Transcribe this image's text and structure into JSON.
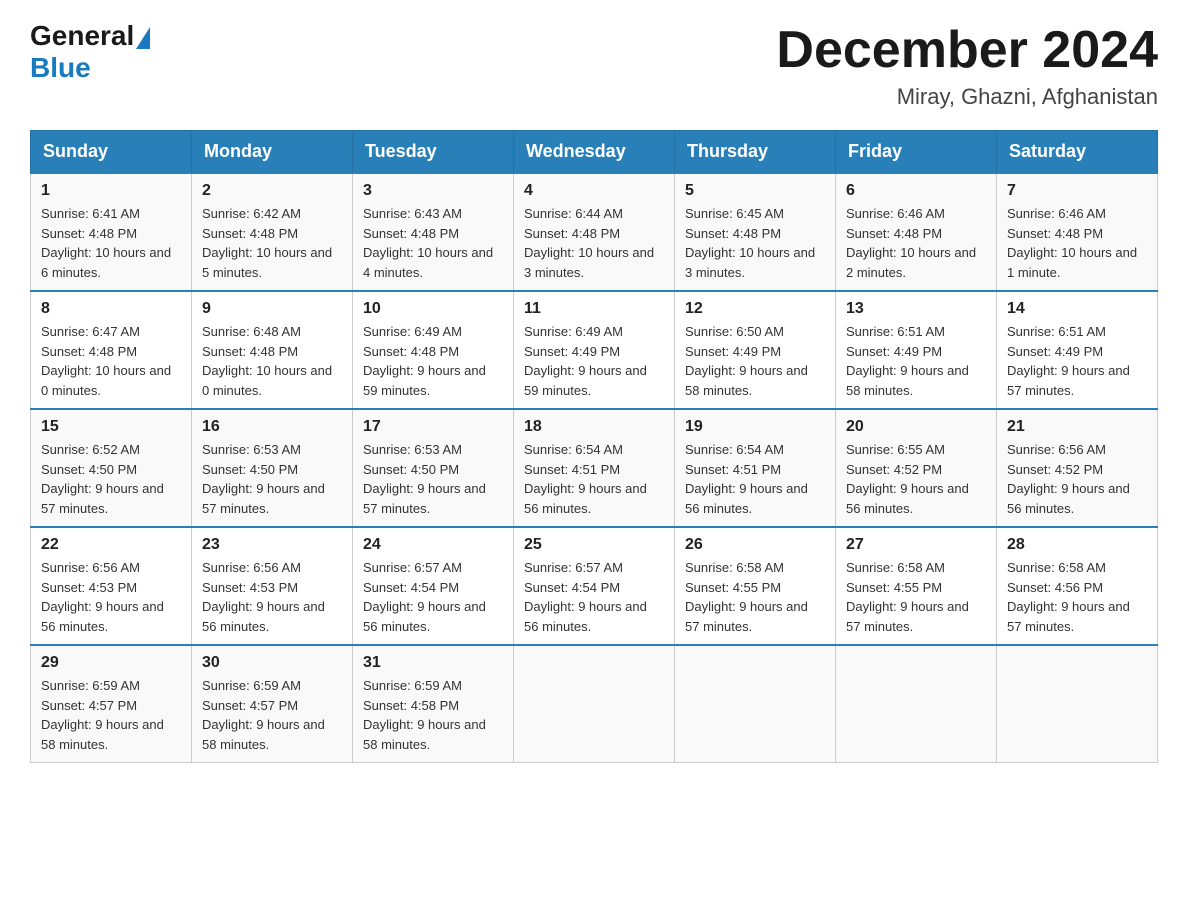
{
  "header": {
    "logo_general": "General",
    "logo_blue": "Blue",
    "month_title": "December 2024",
    "location": "Miray, Ghazni, Afghanistan"
  },
  "days_of_week": [
    "Sunday",
    "Monday",
    "Tuesday",
    "Wednesday",
    "Thursday",
    "Friday",
    "Saturday"
  ],
  "weeks": [
    [
      {
        "day": "1",
        "sunrise": "6:41 AM",
        "sunset": "4:48 PM",
        "daylight": "10 hours and 6 minutes."
      },
      {
        "day": "2",
        "sunrise": "6:42 AM",
        "sunset": "4:48 PM",
        "daylight": "10 hours and 5 minutes."
      },
      {
        "day": "3",
        "sunrise": "6:43 AM",
        "sunset": "4:48 PM",
        "daylight": "10 hours and 4 minutes."
      },
      {
        "day": "4",
        "sunrise": "6:44 AM",
        "sunset": "4:48 PM",
        "daylight": "10 hours and 3 minutes."
      },
      {
        "day": "5",
        "sunrise": "6:45 AM",
        "sunset": "4:48 PM",
        "daylight": "10 hours and 3 minutes."
      },
      {
        "day": "6",
        "sunrise": "6:46 AM",
        "sunset": "4:48 PM",
        "daylight": "10 hours and 2 minutes."
      },
      {
        "day": "7",
        "sunrise": "6:46 AM",
        "sunset": "4:48 PM",
        "daylight": "10 hours and 1 minute."
      }
    ],
    [
      {
        "day": "8",
        "sunrise": "6:47 AM",
        "sunset": "4:48 PM",
        "daylight": "10 hours and 0 minutes."
      },
      {
        "day": "9",
        "sunrise": "6:48 AM",
        "sunset": "4:48 PM",
        "daylight": "10 hours and 0 minutes."
      },
      {
        "day": "10",
        "sunrise": "6:49 AM",
        "sunset": "4:48 PM",
        "daylight": "9 hours and 59 minutes."
      },
      {
        "day": "11",
        "sunrise": "6:49 AM",
        "sunset": "4:49 PM",
        "daylight": "9 hours and 59 minutes."
      },
      {
        "day": "12",
        "sunrise": "6:50 AM",
        "sunset": "4:49 PM",
        "daylight": "9 hours and 58 minutes."
      },
      {
        "day": "13",
        "sunrise": "6:51 AM",
        "sunset": "4:49 PM",
        "daylight": "9 hours and 58 minutes."
      },
      {
        "day": "14",
        "sunrise": "6:51 AM",
        "sunset": "4:49 PM",
        "daylight": "9 hours and 57 minutes."
      }
    ],
    [
      {
        "day": "15",
        "sunrise": "6:52 AM",
        "sunset": "4:50 PM",
        "daylight": "9 hours and 57 minutes."
      },
      {
        "day": "16",
        "sunrise": "6:53 AM",
        "sunset": "4:50 PM",
        "daylight": "9 hours and 57 minutes."
      },
      {
        "day": "17",
        "sunrise": "6:53 AM",
        "sunset": "4:50 PM",
        "daylight": "9 hours and 57 minutes."
      },
      {
        "day": "18",
        "sunrise": "6:54 AM",
        "sunset": "4:51 PM",
        "daylight": "9 hours and 56 minutes."
      },
      {
        "day": "19",
        "sunrise": "6:54 AM",
        "sunset": "4:51 PM",
        "daylight": "9 hours and 56 minutes."
      },
      {
        "day": "20",
        "sunrise": "6:55 AM",
        "sunset": "4:52 PM",
        "daylight": "9 hours and 56 minutes."
      },
      {
        "day": "21",
        "sunrise": "6:56 AM",
        "sunset": "4:52 PM",
        "daylight": "9 hours and 56 minutes."
      }
    ],
    [
      {
        "day": "22",
        "sunrise": "6:56 AM",
        "sunset": "4:53 PM",
        "daylight": "9 hours and 56 minutes."
      },
      {
        "day": "23",
        "sunrise": "6:56 AM",
        "sunset": "4:53 PM",
        "daylight": "9 hours and 56 minutes."
      },
      {
        "day": "24",
        "sunrise": "6:57 AM",
        "sunset": "4:54 PM",
        "daylight": "9 hours and 56 minutes."
      },
      {
        "day": "25",
        "sunrise": "6:57 AM",
        "sunset": "4:54 PM",
        "daylight": "9 hours and 56 minutes."
      },
      {
        "day": "26",
        "sunrise": "6:58 AM",
        "sunset": "4:55 PM",
        "daylight": "9 hours and 57 minutes."
      },
      {
        "day": "27",
        "sunrise": "6:58 AM",
        "sunset": "4:55 PM",
        "daylight": "9 hours and 57 minutes."
      },
      {
        "day": "28",
        "sunrise": "6:58 AM",
        "sunset": "4:56 PM",
        "daylight": "9 hours and 57 minutes."
      }
    ],
    [
      {
        "day": "29",
        "sunrise": "6:59 AM",
        "sunset": "4:57 PM",
        "daylight": "9 hours and 58 minutes."
      },
      {
        "day": "30",
        "sunrise": "6:59 AM",
        "sunset": "4:57 PM",
        "daylight": "9 hours and 58 minutes."
      },
      {
        "day": "31",
        "sunrise": "6:59 AM",
        "sunset": "4:58 PM",
        "daylight": "9 hours and 58 minutes."
      },
      null,
      null,
      null,
      null
    ]
  ]
}
